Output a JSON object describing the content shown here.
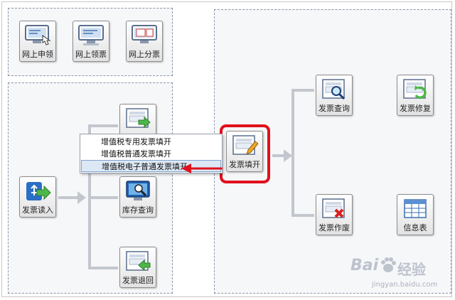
{
  "top_panel": {
    "buttons": [
      {
        "label": "网上申领",
        "icon": "online-apply-icon"
      },
      {
        "label": "网上领票",
        "icon": "online-receive-icon"
      },
      {
        "label": "网上分票",
        "icon": "online-distribute-icon"
      }
    ]
  },
  "left_panel": {
    "read_button": {
      "label": "发票读入",
      "icon": "usb-import-icon"
    },
    "stock_query_button": {
      "label": "库存查询",
      "icon": "monitor-search-icon"
    },
    "return_button": {
      "label": "发票退回",
      "icon": "invoice-return-icon"
    }
  },
  "context_menu": {
    "items": [
      {
        "label": "增值税专用发票填开",
        "selected": false
      },
      {
        "label": "增值税普通发票填开",
        "selected": false
      },
      {
        "label": "增值税电子普通发票填开",
        "selected": true
      }
    ]
  },
  "right_panel": {
    "fill_button": {
      "label": "发票填开",
      "icon": "invoice-edit-icon"
    },
    "query_button": {
      "label": "发票查询",
      "icon": "invoice-search-icon"
    },
    "repair_button": {
      "label": "发票修复",
      "icon": "invoice-repair-icon"
    },
    "void_button": {
      "label": "发票作废",
      "icon": "invoice-void-icon"
    },
    "info_button": {
      "label": "信息表",
      "icon": "table-icon"
    }
  },
  "watermark": {
    "text": "Bai",
    "text2": "经验",
    "sub": "jingyan.baidu.com"
  },
  "colors": {
    "highlight_red": "#e0101c",
    "connector": "#c3c7cd",
    "accent_green": "#3aa53a"
  }
}
